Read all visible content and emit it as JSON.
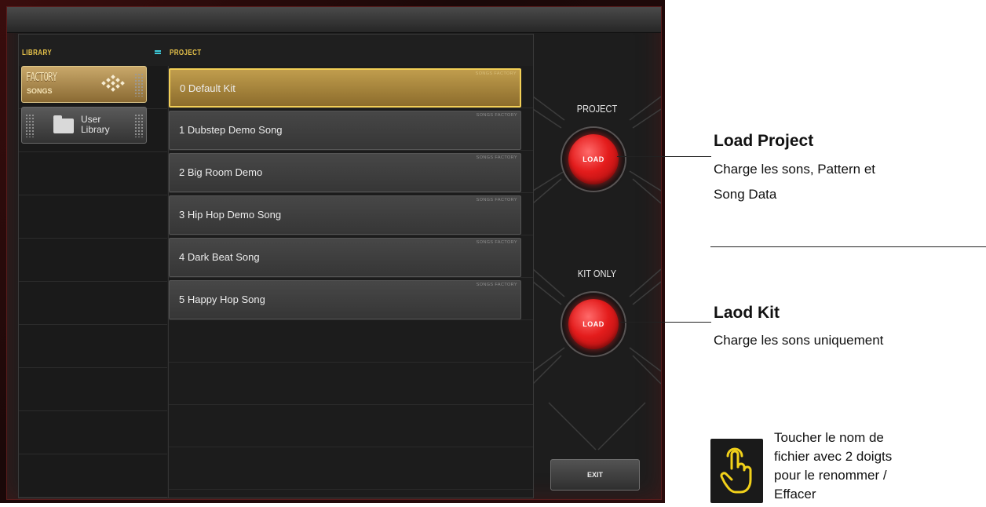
{
  "library": {
    "header": "LIBRARY",
    "items": [
      {
        "title": "FACTORY",
        "subtitle": "SONGS"
      },
      {
        "title": "User Library"
      }
    ]
  },
  "project": {
    "header": "PROJECT",
    "songs": [
      {
        "name": "0 Default Kit",
        "tag": "SONGS FACTORY"
      },
      {
        "name": "1 Dubstep Demo Song",
        "tag": "SONGS FACTORY"
      },
      {
        "name": "2 Big Room Demo",
        "tag": "SONGS FACTORY"
      },
      {
        "name": "3 Hip Hop Demo Song",
        "tag": "SONGS FACTORY"
      },
      {
        "name": "4 Dark Beat Song",
        "tag": "SONGS FACTORY"
      },
      {
        "name": "5 Happy Hop Song",
        "tag": "SONGS FACTORY"
      }
    ]
  },
  "controls": {
    "project_label": "PROJECT",
    "project_load": "LOAD",
    "kit_label": "KIT ONLY",
    "kit_load": "LOAD",
    "exit": "EXIT"
  },
  "annotations": {
    "load_project_title": "Load Project",
    "load_project_desc_1": "Charge les sons, Pattern et",
    "load_project_desc_2": "Song Data",
    "load_kit_title": "Laod Kit",
    "load_kit_desc": "Charge les sons uniquement",
    "hint_1": "Toucher le nom de",
    "hint_2": "fichier avec 2 doigts",
    "hint_3": "pour le renommer /",
    "hint_4": "Effacer"
  },
  "colors": {
    "accent_gold": "#f2cf57",
    "load_red": "#e41c1c",
    "eq_cyan": "#3cc8d8"
  }
}
